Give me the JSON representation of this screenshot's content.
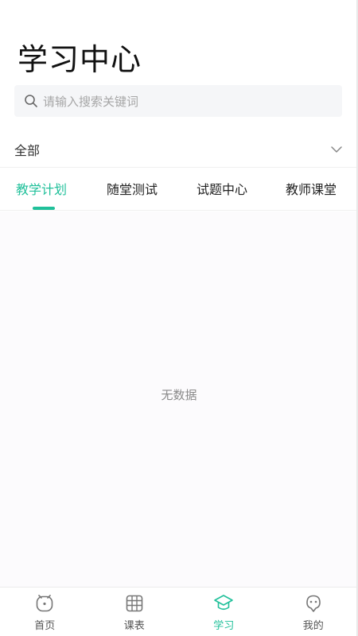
{
  "header": {
    "title": "学习中心"
  },
  "search": {
    "placeholder": "请输入搜索关键词"
  },
  "filter": {
    "label": "全部"
  },
  "tabs": [
    {
      "label": "教学计划",
      "active": true
    },
    {
      "label": "随堂测试",
      "active": false
    },
    {
      "label": "试题中心",
      "active": false
    },
    {
      "label": "教师课堂",
      "active": false
    }
  ],
  "content": {
    "empty_text": "无数据"
  },
  "bottom_nav": [
    {
      "label": "首页",
      "icon": "home-icon",
      "active": false
    },
    {
      "label": "课表",
      "icon": "timetable-icon",
      "active": false
    },
    {
      "label": "学习",
      "icon": "graduation-cap-icon",
      "active": true
    },
    {
      "label": "我的",
      "icon": "profile-icon",
      "active": false
    }
  ],
  "colors": {
    "accent": "#20c09a",
    "text": "#333333",
    "muted": "#8a8a8a"
  }
}
